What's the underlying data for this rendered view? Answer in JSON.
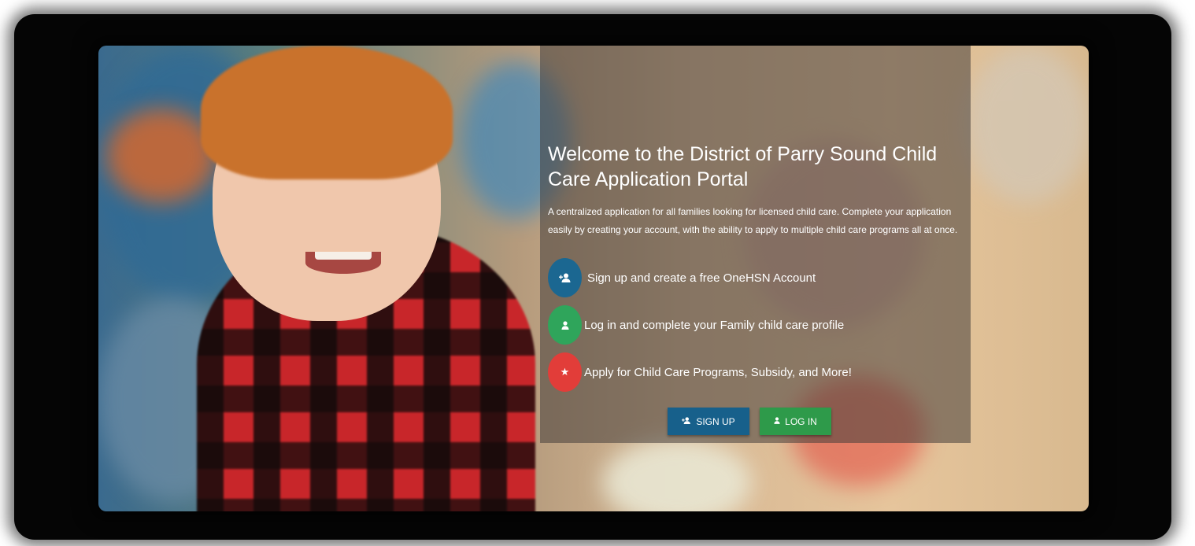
{
  "welcome": {
    "title": "Welcome to the District of Parry Sound Child Care Application Portal",
    "description": "A centralized application for all families looking for licensed child care. Complete your application easily by creating your account, with the ability to apply to multiple child care programs all at once."
  },
  "steps": [
    {
      "icon": "add-user-icon",
      "label": "Sign up and create a free OneHSN Account",
      "color": "#1b6791"
    },
    {
      "icon": "user-icon",
      "label": "Log in and complete your Family child care profile",
      "color": "#2fa55b"
    },
    {
      "icon": "star-icon",
      "label": "Apply for Child Care Programs, Subsidy, and More!",
      "color": "#e23d39"
    }
  ],
  "actions": {
    "signup_label": "SIGN UP",
    "login_label": "LOG IN",
    "signup_color": "#17608b",
    "login_color": "#2e9a4a"
  }
}
